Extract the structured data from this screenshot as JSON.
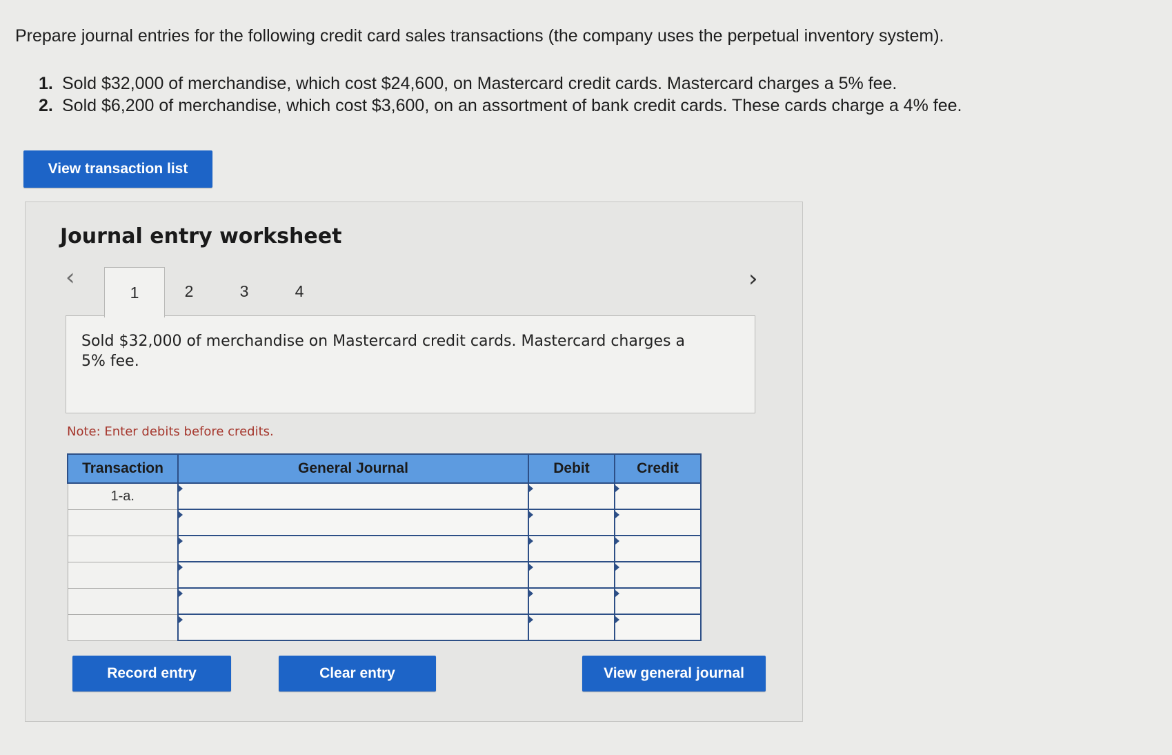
{
  "prompt": "Prepare journal entries for the following credit card sales transactions (the company uses the perpetual inventory system).",
  "transactions": [
    {
      "num": "1.",
      "text": "Sold $32,000 of merchandise, which cost $24,600, on Mastercard credit cards. Mastercard charges a 5% fee."
    },
    {
      "num": "2.",
      "text": "Sold $6,200 of merchandise, which cost $3,600, on an assortment of bank credit cards. These cards charge a 4% fee."
    }
  ],
  "view_transaction_list_label": "View transaction list",
  "worksheet": {
    "title": "Journal entry worksheet",
    "prev_icon": "chevron-left-icon",
    "next_icon": "chevron-right-icon",
    "tabs": [
      "1",
      "2",
      "3",
      "4"
    ],
    "active_tab": "1",
    "description": "Sold $32,000 of merchandise on Mastercard credit cards. Mastercard charges a 5% fee.",
    "note": "Note: Enter debits before credits.",
    "table": {
      "headers": {
        "transaction": "Transaction",
        "general_journal": "General Journal",
        "debit": "Debit",
        "credit": "Credit"
      },
      "rows": [
        {
          "transaction": "1-a.",
          "account": "",
          "debit": "",
          "credit": ""
        },
        {
          "transaction": "",
          "account": "",
          "debit": "",
          "credit": ""
        },
        {
          "transaction": "",
          "account": "",
          "debit": "",
          "credit": ""
        },
        {
          "transaction": "",
          "account": "",
          "debit": "",
          "credit": ""
        },
        {
          "transaction": "",
          "account": "",
          "debit": "",
          "credit": ""
        },
        {
          "transaction": "",
          "account": "",
          "debit": "",
          "credit": ""
        }
      ]
    },
    "buttons": {
      "record": "Record entry",
      "clear": "Clear entry",
      "view_general_journal": "View general journal"
    }
  },
  "colors": {
    "button_blue": "#1d64c7",
    "table_header_blue": "#5d9be0",
    "note_red": "#a5362c"
  }
}
